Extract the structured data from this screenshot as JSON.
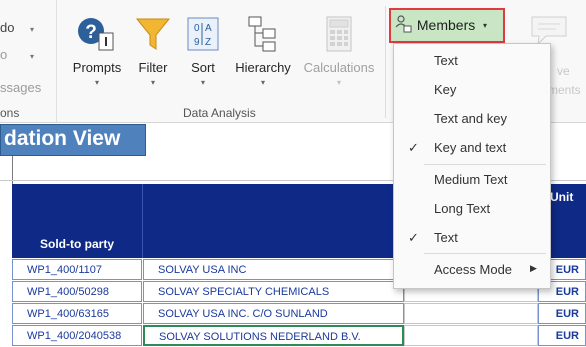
{
  "ribbon": {
    "left_partial": [
      "do",
      "o",
      "ssages",
      "ons"
    ],
    "buttons": {
      "prompts": "Prompts",
      "filter": "Filter",
      "sort": "Sort",
      "hierarchy": "Hierarchy",
      "calculations": "Calculations"
    },
    "group_label": "Data Analysis",
    "members": "Members",
    "right_partial": [
      "ve",
      "ments"
    ]
  },
  "view_title": "dation View",
  "table": {
    "header_sold_to": "Sold-to party",
    "header_unit": "Unit",
    "rows": [
      {
        "id": "WP1_400/1107",
        "name": "SOLVAY USA INC",
        "unit": "EUR"
      },
      {
        "id": "WP1_400/50298",
        "name": "SOLVAY SPECIALTY CHEMICALS",
        "unit": "EUR"
      },
      {
        "id": "WP1_400/63165",
        "name": "SOLVAY USA INC. C/O SUNLAND",
        "unit": "EUR"
      },
      {
        "id": "WP1_400/2040538",
        "name": "SOLVAY SOLUTIONS NEDERLAND B.V.",
        "unit": "EUR"
      }
    ]
  },
  "menu": {
    "items": [
      {
        "label": "Text",
        "checked": false
      },
      {
        "label": "Key",
        "checked": false
      },
      {
        "label": "Text and key",
        "checked": false
      },
      {
        "label": "Key and text",
        "checked": true
      },
      {
        "label": "Medium Text",
        "checked": false
      },
      {
        "label": "Long Text",
        "checked": false
      },
      {
        "label": "Text",
        "checked": true
      },
      {
        "label": "Access Mode",
        "checked": false,
        "submenu": true
      }
    ],
    "check_glyph": "✓"
  },
  "colors": {
    "members_bg": "#c8e6c4",
    "members_border": "#e0393e",
    "header_bg": "#0f2a86",
    "title_bg": "#4f81bd"
  }
}
